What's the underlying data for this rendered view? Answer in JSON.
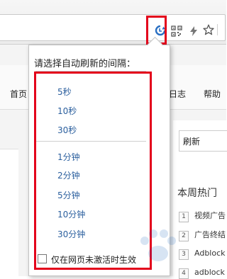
{
  "toolbar": {
    "icons": [
      "auto-refresh-icon",
      "qr-code-icon",
      "lightning-icon",
      "star-icon"
    ],
    "highlight_color": "#e3001b"
  },
  "page": {
    "nav": {
      "home": "首页",
      "log": "日志",
      "help": "帮助"
    },
    "refresh_select": "刷新",
    "hot_title": "本周热门",
    "rankings": [
      {
        "num": "1",
        "text": "视频广告"
      },
      {
        "num": "2",
        "text": "广告终结"
      },
      {
        "num": "3",
        "text": "Adblock"
      },
      {
        "num": "4",
        "text": "adblock"
      }
    ]
  },
  "popup": {
    "title": "请选择自动刷新的间隔：",
    "seconds": [
      "5秒",
      "10秒",
      "30秒"
    ],
    "minutes": [
      "1分钟",
      "2分钟",
      "5分钟",
      "10分钟",
      "30分钟"
    ],
    "checkbox_label": "仅在网页未激活时生效",
    "checkbox_checked": false,
    "link_color": "#2b5f9e"
  }
}
